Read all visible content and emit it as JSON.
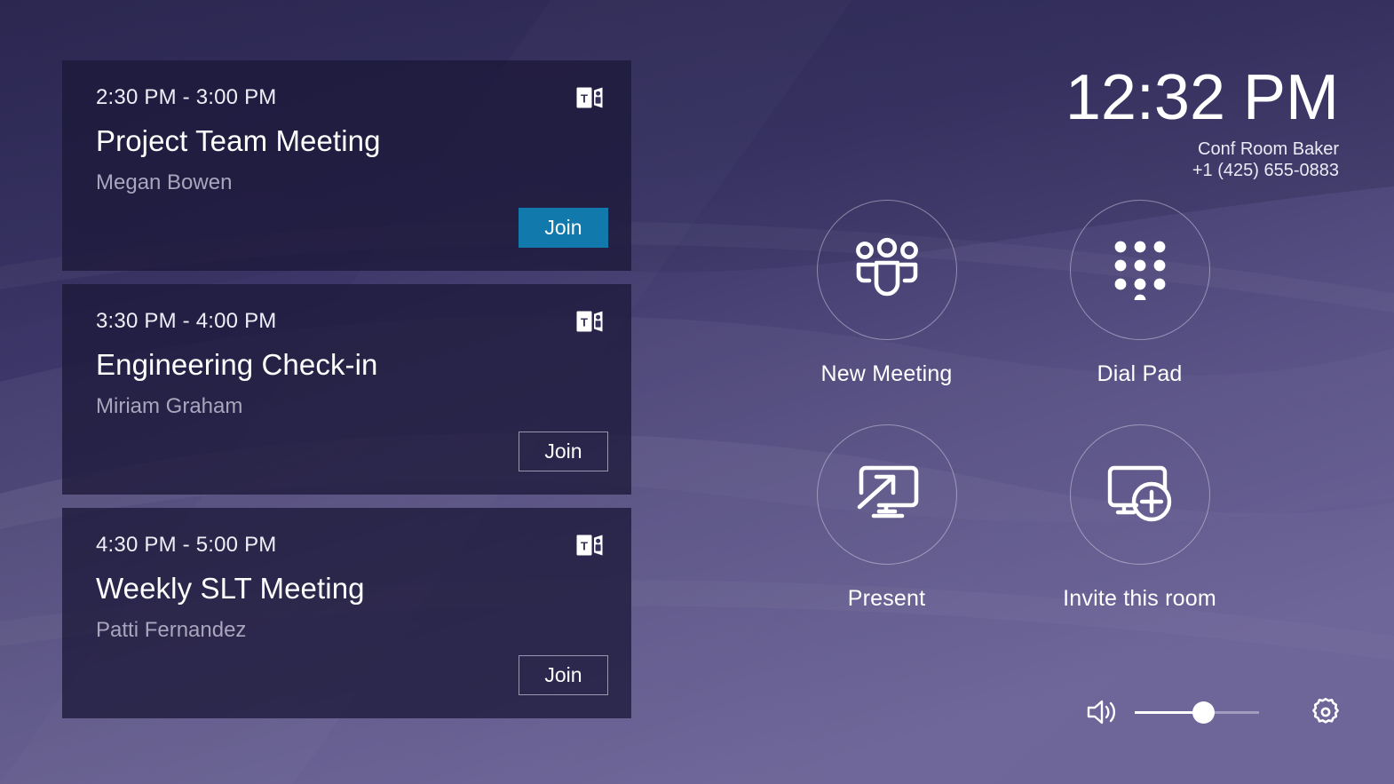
{
  "theme": {
    "background_dark": "#2e2a55",
    "background_light": "#6b6296",
    "card_bg": "#2f2b4e",
    "accent_blue": "#1179ab",
    "text_primary": "#ffffff",
    "text_muted": "#a9a5bd"
  },
  "clock": {
    "time": "12:32 PM",
    "room_name": "Conf Room Baker",
    "phone": "+1 (425) 655-0883"
  },
  "meetings": [
    {
      "time": "2:30 PM - 3:00 PM",
      "title": "Project Team Meeting",
      "organizer": "Megan Bowen",
      "provider_icon": "teams-icon",
      "join_label": "Join",
      "join_style": "primary"
    },
    {
      "time": "3:30 PM - 4:00 PM",
      "title": "Engineering Check-in",
      "organizer": "Miriam Graham",
      "provider_icon": "teams-icon",
      "join_label": "Join",
      "join_style": "outline"
    },
    {
      "time": "4:30 PM - 5:00 PM",
      "title": "Weekly SLT Meeting",
      "organizer": "Patti Fernandez",
      "provider_icon": "teams-icon",
      "join_label": "Join",
      "join_style": "outline"
    }
  ],
  "actions": [
    {
      "label": "New Meeting",
      "icon": "people-group-icon"
    },
    {
      "label": "Dial Pad",
      "icon": "dial-pad-icon"
    },
    {
      "label": "Present",
      "icon": "present-screen-icon"
    },
    {
      "label": "Invite this room",
      "icon": "add-screen-icon"
    }
  ],
  "bottom_bar": {
    "volume_icon": "speaker-volume-icon",
    "volume_percent": 55,
    "settings_icon": "gear-icon"
  }
}
